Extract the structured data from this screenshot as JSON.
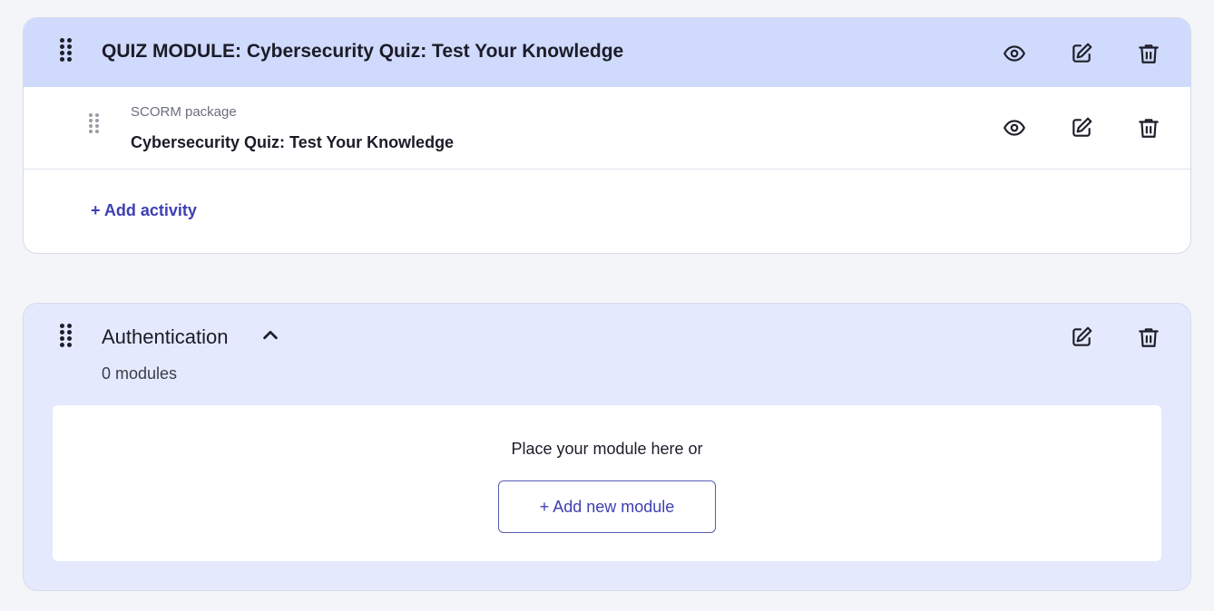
{
  "quiz_module": {
    "title": "QUIZ MODULE: Cybersecurity Quiz: Test Your Knowledge",
    "activity": {
      "type": "SCORM package",
      "title": "Cybersecurity Quiz: Test Your Knowledge"
    },
    "add_activity_label": "+ Add activity",
    "icons": [
      "drag-handle-icon",
      "eye-icon",
      "edit-icon",
      "trash-icon"
    ]
  },
  "section": {
    "title": "Authentication",
    "module_count": "0 modules",
    "dropzone_text": "Place your module here or",
    "add_module_label": "+ Add new module",
    "icons": [
      "drag-handle-icon",
      "chevron-up-icon",
      "edit-icon",
      "trash-icon"
    ]
  },
  "colors": {
    "page_bg": "#f4f5f8",
    "quiz_header_bg": "#cfdafc",
    "section_bg": "#e4e9fd",
    "accent": "#3d3fb3"
  }
}
